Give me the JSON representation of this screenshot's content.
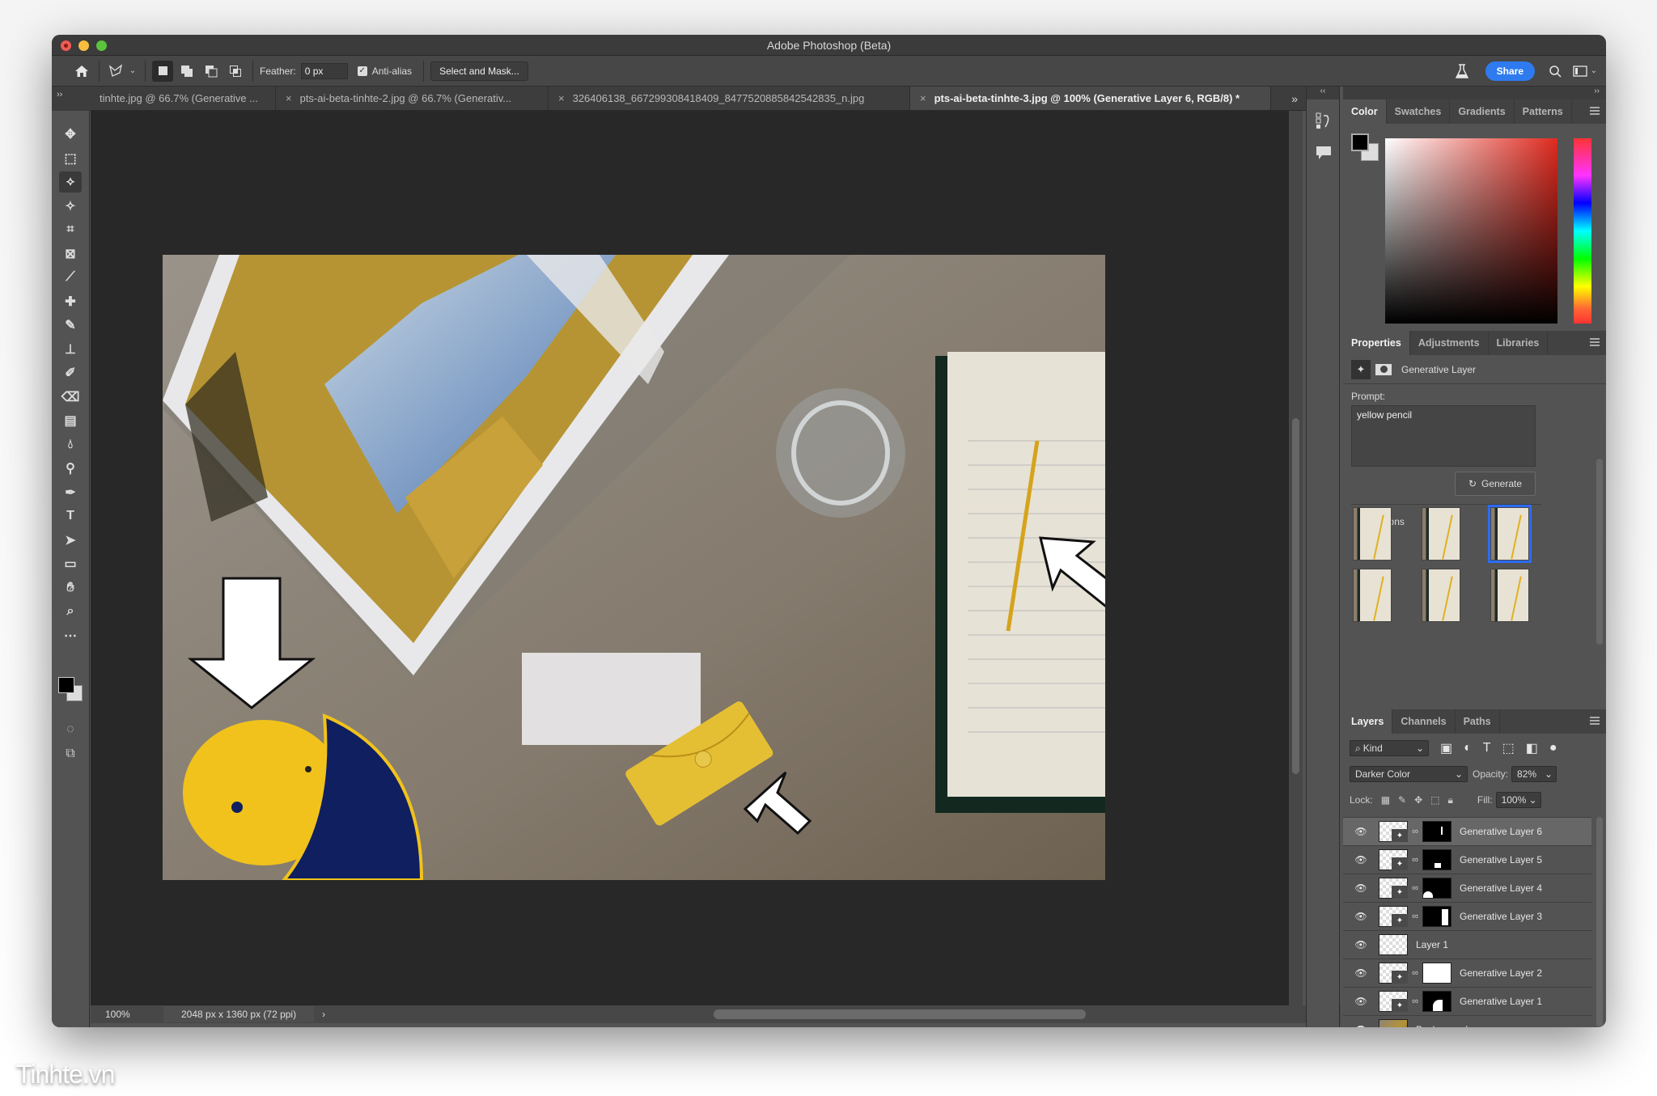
{
  "window": {
    "title": "Adobe Photoshop (Beta)"
  },
  "options_bar": {
    "feather_label": "Feather:",
    "feather_value": "0 px",
    "antialias_label": "Anti-alias",
    "antialias_checked": true,
    "select_mask_label": "Select and Mask...",
    "share_label": "Share"
  },
  "tabs": [
    {
      "label": "tinhte.jpg @ 66.7% (Generative ...",
      "active": false
    },
    {
      "label": "pts-ai-beta-tinhte-2.jpg @ 66.7% (Generativ...",
      "active": false
    },
    {
      "label": "326406138_667299308418409_8477520885842542835_n.jpg",
      "active": false
    },
    {
      "label": "pts-ai-beta-tinhte-3.jpg @ 100% (Generative Layer 6, RGB/8) *",
      "active": true
    }
  ],
  "tools": [
    "move",
    "marquee",
    "lasso",
    "magic-wand",
    "crop",
    "frame",
    "eyedropper",
    "healing",
    "brush",
    "stamp",
    "history-brush",
    "eraser",
    "gradient",
    "blur",
    "dodge",
    "pen",
    "type",
    "path-select",
    "rectangle",
    "hand",
    "zoom",
    "more"
  ],
  "status": {
    "zoom": "100%",
    "doc_info": "2048 px x 1360 px (72 ppi)"
  },
  "color_panel": {
    "tabs": [
      "Color",
      "Swatches",
      "Gradients",
      "Patterns"
    ],
    "active_tab": "Color",
    "foreground": "#000000",
    "background": "#dddddd"
  },
  "properties_panel": {
    "tabs": [
      "Properties",
      "Adjustments",
      "Libraries"
    ],
    "active_tab": "Properties",
    "layer_type": "Generative Layer",
    "prompt_label": "Prompt:",
    "prompt_value": "yellow pencil",
    "generate_label": "Generate",
    "variations_label": "Variations",
    "variations_count": 6,
    "selected_variation": 3
  },
  "layers_panel": {
    "tabs": [
      "Layers",
      "Channels",
      "Paths"
    ],
    "active_tab": "Layers",
    "filter_label": "Kind",
    "blend_mode": "Darker Color",
    "opacity_label": "Opacity:",
    "opacity_value": "82%",
    "lock_label": "Lock:",
    "fill_label": "Fill:",
    "fill_value": "100%",
    "layers": [
      {
        "name": "Generative Layer 6",
        "selected": true,
        "generative": true
      },
      {
        "name": "Generative Layer 5",
        "selected": false,
        "generative": true
      },
      {
        "name": "Generative Layer 4",
        "selected": false,
        "generative": true
      },
      {
        "name": "Generative Layer 3",
        "selected": false,
        "generative": true
      },
      {
        "name": "Layer 1",
        "selected": false,
        "generative": false
      },
      {
        "name": "Generative Layer 2",
        "selected": false,
        "generative": true
      },
      {
        "name": "Generative Layer 1",
        "selected": false,
        "generative": true
      },
      {
        "name": "Background",
        "selected": false,
        "generative": false,
        "locked": true
      }
    ]
  },
  "watermark": "Tinhte.vn",
  "colors": {
    "accent": "#2e7bf0",
    "panel": "#535353",
    "canvas_bg": "#282828"
  }
}
